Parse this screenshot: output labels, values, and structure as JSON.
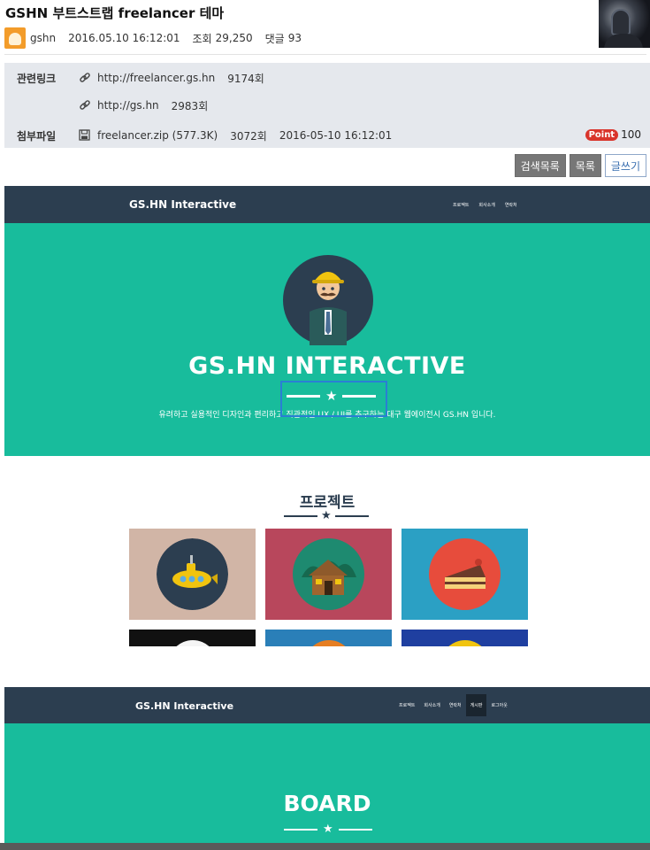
{
  "post": {
    "title": "GSHN 부트스트랩 freelancer 테마",
    "author": "gshn",
    "datetime": "2016.05.10 16:12:01",
    "views_label": "조회",
    "views": "29,250",
    "comments_label": "댓글",
    "comments": "93"
  },
  "info": {
    "links_label": "관련링크",
    "links": [
      {
        "url": "http://freelancer.gs.hn",
        "count": "9174회"
      },
      {
        "url": "http://gs.hn",
        "count": "2983회"
      }
    ],
    "file_label": "첨부파일",
    "file": {
      "name": "freelancer.zip (577.3K)",
      "count": "3072회",
      "date": "2016-05-10 16:12:01"
    },
    "point_badge": "Point",
    "point_value": "100"
  },
  "buttons": {
    "search_list": "검색목록",
    "list": "목록",
    "write": "글쓰기"
  },
  "preview1": {
    "brand": "GS.HN Interactive",
    "menu": [
      "프로젝트",
      "회사소개",
      "연락처"
    ],
    "hero_title": "GS.HN INTERACTIVE",
    "hero_subtitle": "유려하고 실용적인 디자인과 편리하고 직관적인 UX / UI를 추구하는 대구 웹에이전시 GS.HN 입니다.",
    "section_title": "프로젝트"
  },
  "preview2": {
    "brand": "GS.HN Interactive",
    "menu": [
      "프로젝트",
      "회사소개",
      "연락처",
      "게시판",
      "로그아웃"
    ],
    "active_menu": "게시판",
    "hero_title": "BOARD"
  },
  "colors": {
    "navy": "#2c3e50",
    "teal": "#18bc9c",
    "selection": "#2a7fd4",
    "point_red": "#d9342b"
  }
}
